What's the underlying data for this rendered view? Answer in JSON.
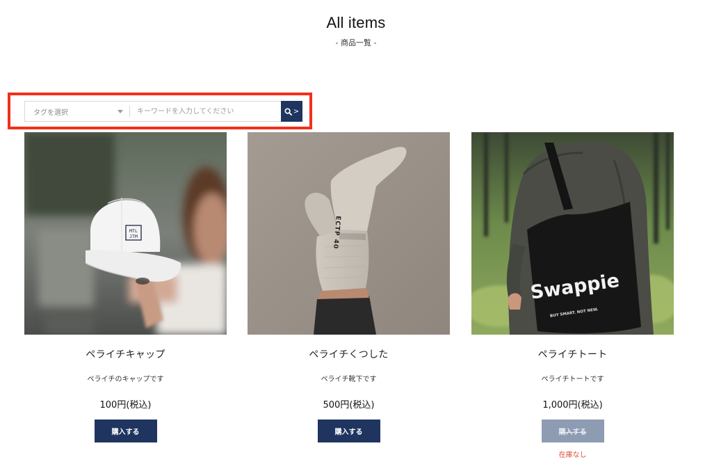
{
  "header": {
    "title": "All items",
    "subtitle": "- 商品一覧 -"
  },
  "search": {
    "tag_select_label": "タグを選択",
    "keyword_placeholder": "キーワードを入力してください",
    "button_arrow": ">"
  },
  "products": [
    {
      "name": "ペライチキャップ",
      "description": "ペライチのキャップです",
      "price": "100円(税込)",
      "buy_label": "購入する"
    },
    {
      "name": "ペライチくつした",
      "description": "ペライチ靴下です",
      "price": "500円(税込)",
      "buy_label": "購入する"
    },
    {
      "name": "ペライチトート",
      "description": "ペライチトートです",
      "price": "1,000円(税込)",
      "buy_label": "購入する",
      "stock_status": "在庫なし"
    }
  ],
  "photo_texts": {
    "cap_logo_top": "MTL",
    "cap_logo_bottom": "JTM",
    "sock_text": "ECTP 40",
    "tote_brand": "Swappie",
    "tote_tagline": "BUY SMART. NOT NEW."
  },
  "colors": {
    "accent_navy": "#1f3560",
    "disabled_button": "#8d9cb3",
    "highlight_red": "#f2301b",
    "out_of_stock_red": "#e04a3a"
  }
}
